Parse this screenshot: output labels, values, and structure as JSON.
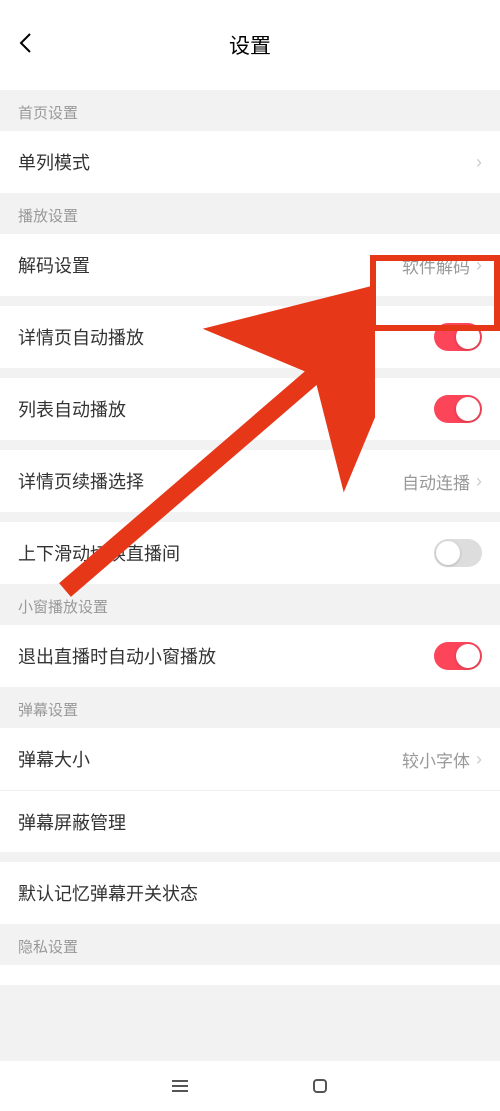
{
  "header": {
    "title": "设置"
  },
  "sections": {
    "home": {
      "title": "首页设置",
      "single_col": {
        "label": "单列模式"
      }
    },
    "play": {
      "title": "播放设置",
      "decode": {
        "label": "解码设置",
        "value": "软件解码"
      },
      "detail_autoplay": {
        "label": "详情页自动播放",
        "on": true
      },
      "list_autoplay": {
        "label": "列表自动播放",
        "on": true
      },
      "detail_continue": {
        "label": "详情页续播选择",
        "value": "自动连播"
      },
      "swipe_room": {
        "label": "上下滑动切换直播间",
        "on": false
      }
    },
    "pip": {
      "title": "小窗播放设置",
      "exit_pip": {
        "label": "退出直播时自动小窗播放",
        "on": true
      }
    },
    "danmu": {
      "title": "弹幕设置",
      "size": {
        "label": "弹幕大小",
        "value": "较小字体"
      },
      "filter": {
        "label": "弹幕屏蔽管理"
      },
      "remember": {
        "label": "默认记忆弹幕开关状态"
      }
    },
    "privacy": {
      "title": "隐私设置"
    }
  }
}
